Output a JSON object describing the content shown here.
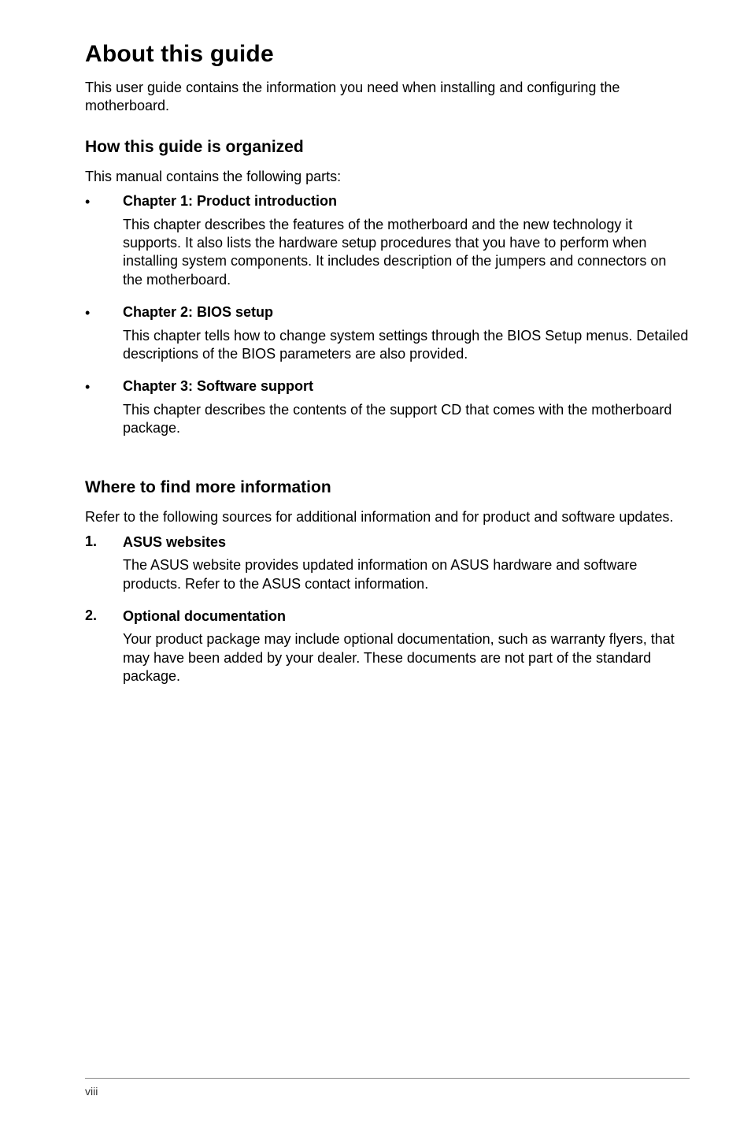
{
  "title": "About this guide",
  "intro": "This user guide contains the information you need when installing and configuring the motherboard.",
  "section1": {
    "heading": "How this guide is organized",
    "intro": "This manual contains the following parts:",
    "items": [
      {
        "heading": "Chapter 1: Product introduction",
        "body": "This chapter describes the features of the motherboard and the new technology it supports. It also lists the hardware setup procedures that you have to perform when installing system components. It includes description of the jumpers and connectors on the motherboard."
      },
      {
        "heading": "Chapter 2: BIOS setup",
        "body": "This chapter tells how to change system settings through the BIOS Setup menus. Detailed descriptions of the BIOS parameters are also provided."
      },
      {
        "heading": "Chapter 3: Software support",
        "body": "This chapter describes the contents of the support CD that comes with the motherboard package."
      }
    ]
  },
  "section2": {
    "heading": "Where to find more information",
    "intro": "Refer to the following sources for additional information and for product and software updates.",
    "items": [
      {
        "number": "1.",
        "heading": "ASUS websites",
        "body": "The ASUS website provides updated information on ASUS hardware and software products. Refer to the ASUS contact information."
      },
      {
        "number": "2.",
        "heading": "Optional documentation",
        "body": "Your product package may include optional documentation, such as warranty flyers, that may have been added by your dealer. These documents are not part of the standard package."
      }
    ]
  },
  "footer": {
    "page": "viii"
  }
}
